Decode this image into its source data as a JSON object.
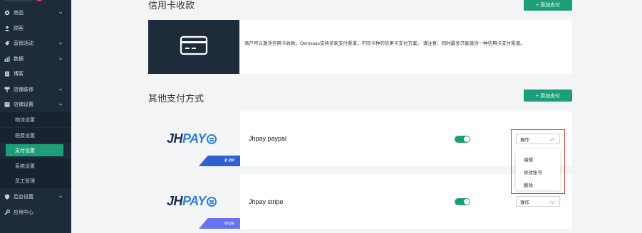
{
  "sidebar": {
    "items": [
      {
        "label": "商品",
        "icon": "box-icon",
        "has_chevron": true
      },
      {
        "label": "顾客",
        "icon": "user-icon",
        "has_chevron": false
      },
      {
        "label": "营销活动",
        "icon": "tag-icon",
        "has_chevron": true
      },
      {
        "label": "数据",
        "icon": "bar-chart-icon",
        "has_chevron": true
      },
      {
        "label": "博客",
        "icon": "document-icon",
        "has_chevron": false
      },
      {
        "label": "店铺装修",
        "icon": "brush-icon",
        "has_chevron": true
      },
      {
        "label": "店铺设置",
        "icon": "shop-icon",
        "has_chevron": true,
        "expanded": true
      }
    ],
    "subitems": [
      {
        "label": "物流设置",
        "active": false
      },
      {
        "label": "税费设置",
        "active": false
      },
      {
        "label": "支付设置",
        "active": true
      },
      {
        "label": "系统设置",
        "active": false
      },
      {
        "label": "员工管理",
        "active": false
      }
    ],
    "bottom_items": [
      {
        "label": "后台设置",
        "icon": "shield-icon",
        "has_chevron": true
      },
      {
        "label": "应用中心",
        "icon": "wrench-icon",
        "has_chevron": false
      }
    ]
  },
  "credit_card_section": {
    "title": "信用卡收款",
    "add_button": "+ 添加支付",
    "description": "商户可以激活信用卡收款。Oemsaas支持多家支付渠道，不同卡种的信用卡支付方案。 请注意：同时最多只能激活一种信用卡支付渠道。",
    "icon": "credit-card-icon"
  },
  "other_section": {
    "title": "其他支付方式",
    "add_button": "+ 添加支付",
    "methods": [
      {
        "logo_text_1": "JH",
        "logo_text_2": "PAY",
        "corner_badge": "P PP",
        "name": "Jhpay paypal",
        "enabled": true,
        "action_select": "操作",
        "dropdown_open": true
      },
      {
        "logo_text_1": "JH",
        "logo_text_2": "PAY",
        "corner_badge": "stripe",
        "name": "Jhpay stripe",
        "enabled": true,
        "action_select": "操作",
        "dropdown_open": false
      }
    ],
    "dropdown_options": [
      "编辑",
      "修改账号",
      "删除"
    ]
  },
  "colors": {
    "sidebar_bg": "#1e2b3a",
    "accent": "#1d9e7a",
    "highlight": "#e53935",
    "page_bg": "#f2f4f6"
  }
}
